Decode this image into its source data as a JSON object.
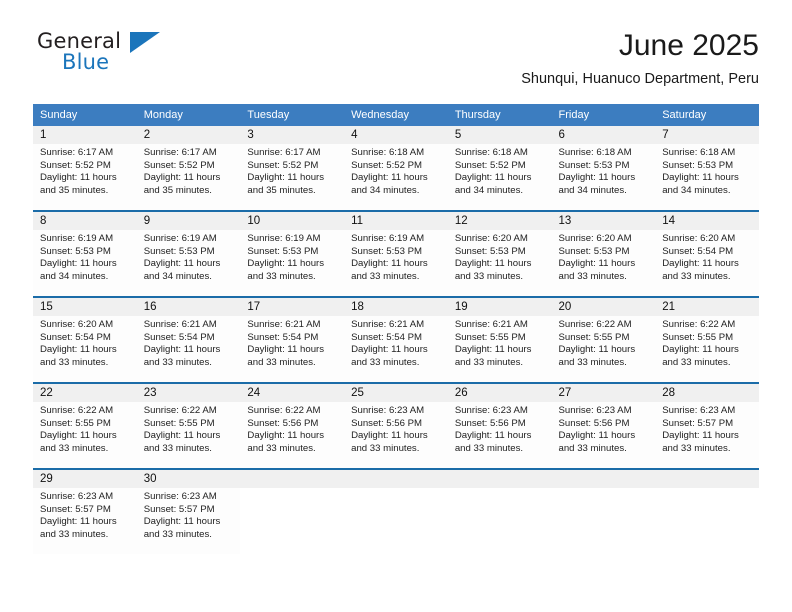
{
  "brand": {
    "name_top": "General",
    "name_bottom": "Blue",
    "color_dark": "#231f20",
    "color_blue": "#1b75bb"
  },
  "header": {
    "title": "June 2025",
    "subtitle": "Shunqui, Huanuco Department, Peru"
  },
  "theme": {
    "header_blue": "#3c7dc0",
    "separator_blue": "#1b6ca8",
    "daynum_band": "#f0f0f0"
  },
  "calendar": {
    "weekday_headers": [
      "Sunday",
      "Monday",
      "Tuesday",
      "Wednesday",
      "Thursday",
      "Friday",
      "Saturday"
    ],
    "weeks": [
      [
        {
          "day": "1",
          "sunrise": "Sunrise: 6:17 AM",
          "sunset": "Sunset: 5:52 PM",
          "daylight1": "Daylight: 11 hours",
          "daylight2": "and 35 minutes."
        },
        {
          "day": "2",
          "sunrise": "Sunrise: 6:17 AM",
          "sunset": "Sunset: 5:52 PM",
          "daylight1": "Daylight: 11 hours",
          "daylight2": "and 35 minutes."
        },
        {
          "day": "3",
          "sunrise": "Sunrise: 6:17 AM",
          "sunset": "Sunset: 5:52 PM",
          "daylight1": "Daylight: 11 hours",
          "daylight2": "and 35 minutes."
        },
        {
          "day": "4",
          "sunrise": "Sunrise: 6:18 AM",
          "sunset": "Sunset: 5:52 PM",
          "daylight1": "Daylight: 11 hours",
          "daylight2": "and 34 minutes."
        },
        {
          "day": "5",
          "sunrise": "Sunrise: 6:18 AM",
          "sunset": "Sunset: 5:52 PM",
          "daylight1": "Daylight: 11 hours",
          "daylight2": "and 34 minutes."
        },
        {
          "day": "6",
          "sunrise": "Sunrise: 6:18 AM",
          "sunset": "Sunset: 5:53 PM",
          "daylight1": "Daylight: 11 hours",
          "daylight2": "and 34 minutes."
        },
        {
          "day": "7",
          "sunrise": "Sunrise: 6:18 AM",
          "sunset": "Sunset: 5:53 PM",
          "daylight1": "Daylight: 11 hours",
          "daylight2": "and 34 minutes."
        }
      ],
      [
        {
          "day": "8",
          "sunrise": "Sunrise: 6:19 AM",
          "sunset": "Sunset: 5:53 PM",
          "daylight1": "Daylight: 11 hours",
          "daylight2": "and 34 minutes."
        },
        {
          "day": "9",
          "sunrise": "Sunrise: 6:19 AM",
          "sunset": "Sunset: 5:53 PM",
          "daylight1": "Daylight: 11 hours",
          "daylight2": "and 34 minutes."
        },
        {
          "day": "10",
          "sunrise": "Sunrise: 6:19 AM",
          "sunset": "Sunset: 5:53 PM",
          "daylight1": "Daylight: 11 hours",
          "daylight2": "and 33 minutes."
        },
        {
          "day": "11",
          "sunrise": "Sunrise: 6:19 AM",
          "sunset": "Sunset: 5:53 PM",
          "daylight1": "Daylight: 11 hours",
          "daylight2": "and 33 minutes."
        },
        {
          "day": "12",
          "sunrise": "Sunrise: 6:20 AM",
          "sunset": "Sunset: 5:53 PM",
          "daylight1": "Daylight: 11 hours",
          "daylight2": "and 33 minutes."
        },
        {
          "day": "13",
          "sunrise": "Sunrise: 6:20 AM",
          "sunset": "Sunset: 5:53 PM",
          "daylight1": "Daylight: 11 hours",
          "daylight2": "and 33 minutes."
        },
        {
          "day": "14",
          "sunrise": "Sunrise: 6:20 AM",
          "sunset": "Sunset: 5:54 PM",
          "daylight1": "Daylight: 11 hours",
          "daylight2": "and 33 minutes."
        }
      ],
      [
        {
          "day": "15",
          "sunrise": "Sunrise: 6:20 AM",
          "sunset": "Sunset: 5:54 PM",
          "daylight1": "Daylight: 11 hours",
          "daylight2": "and 33 minutes."
        },
        {
          "day": "16",
          "sunrise": "Sunrise: 6:21 AM",
          "sunset": "Sunset: 5:54 PM",
          "daylight1": "Daylight: 11 hours",
          "daylight2": "and 33 minutes."
        },
        {
          "day": "17",
          "sunrise": "Sunrise: 6:21 AM",
          "sunset": "Sunset: 5:54 PM",
          "daylight1": "Daylight: 11 hours",
          "daylight2": "and 33 minutes."
        },
        {
          "day": "18",
          "sunrise": "Sunrise: 6:21 AM",
          "sunset": "Sunset: 5:54 PM",
          "daylight1": "Daylight: 11 hours",
          "daylight2": "and 33 minutes."
        },
        {
          "day": "19",
          "sunrise": "Sunrise: 6:21 AM",
          "sunset": "Sunset: 5:55 PM",
          "daylight1": "Daylight: 11 hours",
          "daylight2": "and 33 minutes."
        },
        {
          "day": "20",
          "sunrise": "Sunrise: 6:22 AM",
          "sunset": "Sunset: 5:55 PM",
          "daylight1": "Daylight: 11 hours",
          "daylight2": "and 33 minutes."
        },
        {
          "day": "21",
          "sunrise": "Sunrise: 6:22 AM",
          "sunset": "Sunset: 5:55 PM",
          "daylight1": "Daylight: 11 hours",
          "daylight2": "and 33 minutes."
        }
      ],
      [
        {
          "day": "22",
          "sunrise": "Sunrise: 6:22 AM",
          "sunset": "Sunset: 5:55 PM",
          "daylight1": "Daylight: 11 hours",
          "daylight2": "and 33 minutes."
        },
        {
          "day": "23",
          "sunrise": "Sunrise: 6:22 AM",
          "sunset": "Sunset: 5:55 PM",
          "daylight1": "Daylight: 11 hours",
          "daylight2": "and 33 minutes."
        },
        {
          "day": "24",
          "sunrise": "Sunrise: 6:22 AM",
          "sunset": "Sunset: 5:56 PM",
          "daylight1": "Daylight: 11 hours",
          "daylight2": "and 33 minutes."
        },
        {
          "day": "25",
          "sunrise": "Sunrise: 6:23 AM",
          "sunset": "Sunset: 5:56 PM",
          "daylight1": "Daylight: 11 hours",
          "daylight2": "and 33 minutes."
        },
        {
          "day": "26",
          "sunrise": "Sunrise: 6:23 AM",
          "sunset": "Sunset: 5:56 PM",
          "daylight1": "Daylight: 11 hours",
          "daylight2": "and 33 minutes."
        },
        {
          "day": "27",
          "sunrise": "Sunrise: 6:23 AM",
          "sunset": "Sunset: 5:56 PM",
          "daylight1": "Daylight: 11 hours",
          "daylight2": "and 33 minutes."
        },
        {
          "day": "28",
          "sunrise": "Sunrise: 6:23 AM",
          "sunset": "Sunset: 5:57 PM",
          "daylight1": "Daylight: 11 hours",
          "daylight2": "and 33 minutes."
        }
      ],
      [
        {
          "day": "29",
          "sunrise": "Sunrise: 6:23 AM",
          "sunset": "Sunset: 5:57 PM",
          "daylight1": "Daylight: 11 hours",
          "daylight2": "and 33 minutes."
        },
        {
          "day": "30",
          "sunrise": "Sunrise: 6:23 AM",
          "sunset": "Sunset: 5:57 PM",
          "daylight1": "Daylight: 11 hours",
          "daylight2": "and 33 minutes."
        },
        {
          "day": "",
          "sunrise": "",
          "sunset": "",
          "daylight1": "",
          "daylight2": ""
        },
        {
          "day": "",
          "sunrise": "",
          "sunset": "",
          "daylight1": "",
          "daylight2": ""
        },
        {
          "day": "",
          "sunrise": "",
          "sunset": "",
          "daylight1": "",
          "daylight2": ""
        },
        {
          "day": "",
          "sunrise": "",
          "sunset": "",
          "daylight1": "",
          "daylight2": ""
        },
        {
          "day": "",
          "sunrise": "",
          "sunset": "",
          "daylight1": "",
          "daylight2": ""
        }
      ]
    ]
  }
}
